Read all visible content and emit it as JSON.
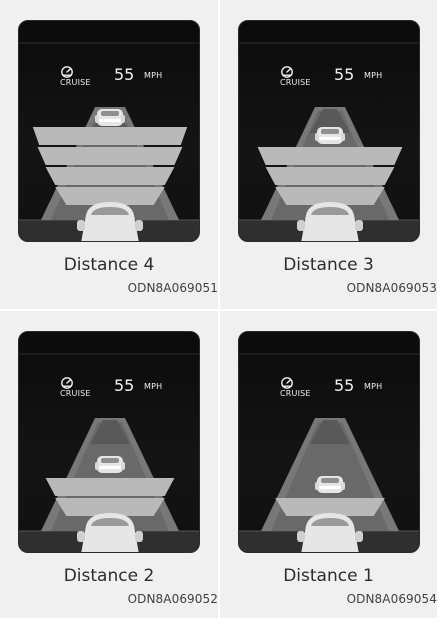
{
  "panels": [
    {
      "caption": "Distance 4",
      "code": "ODN8A069051",
      "cruise_label": "CRUISE",
      "speed_value": "55",
      "speed_unit": "MPH",
      "bars": 4
    },
    {
      "caption": "Distance 3",
      "code": "ODN8A069053",
      "cruise_label": "CRUISE",
      "speed_value": "55",
      "speed_unit": "MPH",
      "bars": 3
    },
    {
      "caption": "Distance 2",
      "code": "ODN8A069052",
      "cruise_label": "CRUISE",
      "speed_value": "55",
      "speed_unit": "MPH",
      "bars": 2
    },
    {
      "caption": "Distance 1",
      "code": "ODN8A069054",
      "cruise_label": "CRUISE",
      "speed_value": "55",
      "speed_unit": "MPH",
      "bars": 1
    }
  ],
  "colors": {
    "screen": "#111111",
    "road": "#787878",
    "bar": "#b9b9b9",
    "car": "#e6e6e6"
  }
}
